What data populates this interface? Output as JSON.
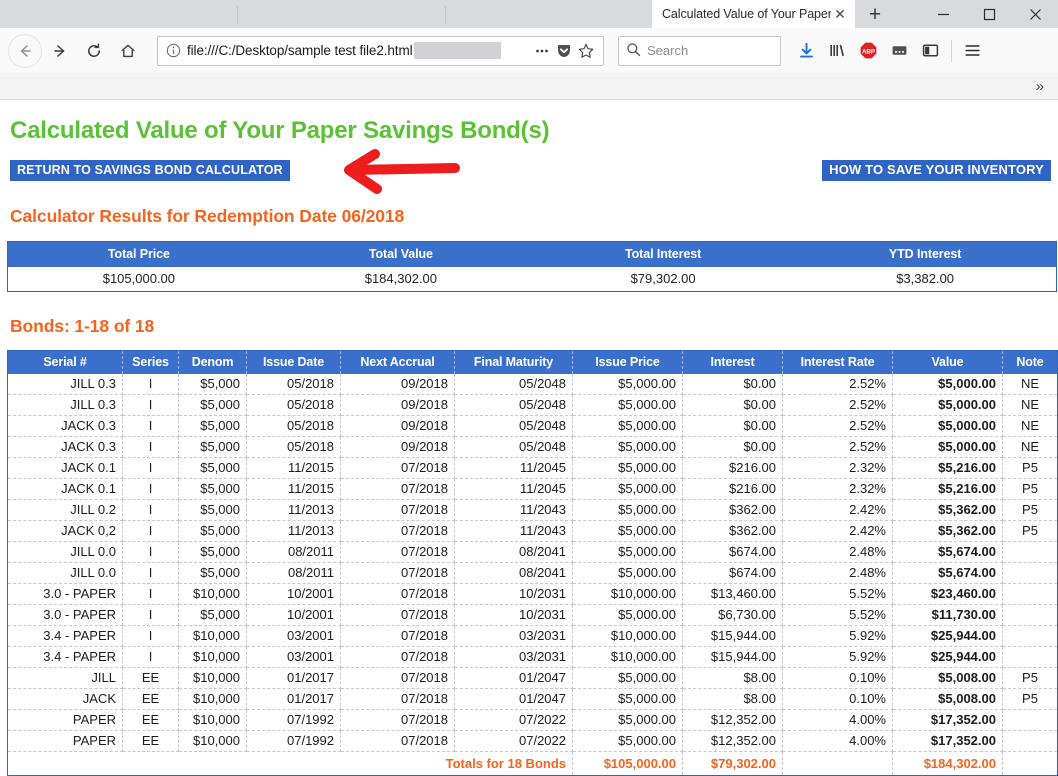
{
  "browser": {
    "tab": {
      "title": "Calculated Value of Your Paper",
      "close_label": "✕"
    },
    "new_tab_label": "+",
    "window_controls": {
      "minimize": "─",
      "maximize": "□",
      "close": "✕"
    },
    "nav": {
      "back": "back-arrow",
      "forward": "forward-arrow",
      "reload": "reload-arrow",
      "home": "home-house"
    },
    "url": {
      "value": "file:///C:/Desktop/sample test file2.html",
      "identity_icon": "info-circle",
      "page_actions": "ellipsis",
      "pocket": "pocket-shield",
      "bookmark": "star-outline"
    },
    "search": {
      "placeholder": "Search",
      "icon": "magnifier"
    },
    "toolbar_icons": [
      {
        "name": "downloads",
        "label": ""
      },
      {
        "name": "library",
        "label": ""
      },
      {
        "name": "adblock-plus",
        "label": "ABP"
      },
      {
        "name": "pocket-list",
        "label": ""
      },
      {
        "name": "sidebar-toggle",
        "label": ""
      },
      {
        "name": "app-menu",
        "label": ""
      }
    ],
    "bookmarks_overflow": "»"
  },
  "page": {
    "title": "Calculated Value of Your Paper Savings Bond(s)",
    "buttons": {
      "return_calculator": "RETURN TO SAVINGS BOND CALCULATOR",
      "how_to_save": "HOW TO SAVE YOUR INVENTORY"
    },
    "annotation": {
      "type": "red-left-arrow",
      "color": "#ee1c1c"
    },
    "results_heading": "Calculator Results for Redemption Date 06/2018",
    "bonds_heading": "Bonds: 1-18 of 18"
  },
  "colors": {
    "title_green": "#5ac334",
    "heading_orange": "#f4641e",
    "table_blue": "#3b6fcc",
    "button_blue": "#2f63c4",
    "arrow_red": "#ee1c1c"
  },
  "summary": {
    "headers": [
      "Total Price",
      "Total Value",
      "Total Interest",
      "YTD Interest"
    ],
    "values": [
      "$105,000.00",
      "$184,302.00",
      "$79,302.00",
      "$3,382.00"
    ]
  },
  "bonds_table": {
    "headers": [
      "Serial #",
      "Series",
      "Denom",
      "Issue Date",
      "Next Accrual",
      "Final Maturity",
      "Issue Price",
      "Interest",
      "Interest Rate",
      "Value",
      "Note"
    ],
    "rows": [
      [
        "JILL 0.3",
        "I",
        "$5,000",
        "05/2018",
        "09/2018",
        "05/2048",
        "$5,000.00",
        "$0.00",
        "2.52%",
        "$5,000.00",
        "NE"
      ],
      [
        "JILL 0.3",
        "I",
        "$5,000",
        "05/2018",
        "09/2018",
        "05/2048",
        "$5,000.00",
        "$0.00",
        "2.52%",
        "$5,000.00",
        "NE"
      ],
      [
        "JACK 0.3",
        "I",
        "$5,000",
        "05/2018",
        "09/2018",
        "05/2048",
        "$5,000.00",
        "$0.00",
        "2.52%",
        "$5,000.00",
        "NE"
      ],
      [
        "JACK 0.3",
        "I",
        "$5,000",
        "05/2018",
        "09/2018",
        "05/2048",
        "$5,000.00",
        "$0.00",
        "2.52%",
        "$5,000.00",
        "NE"
      ],
      [
        "JACK 0.1",
        "I",
        "$5,000",
        "11/2015",
        "07/2018",
        "11/2045",
        "$5,000.00",
        "$216.00",
        "2.32%",
        "$5,216.00",
        "P5"
      ],
      [
        "JACK 0.1",
        "I",
        "$5,000",
        "11/2015",
        "07/2018",
        "11/2045",
        "$5,000.00",
        "$216.00",
        "2.32%",
        "$5,216.00",
        "P5"
      ],
      [
        "JILL 0.2",
        "I",
        "$5,000",
        "11/2013",
        "07/2018",
        "11/2043",
        "$5,000.00",
        "$362.00",
        "2.42%",
        "$5,362.00",
        "P5"
      ],
      [
        "JACK 0,2",
        "I",
        "$5,000",
        "11/2013",
        "07/2018",
        "11/2043",
        "$5,000.00",
        "$362.00",
        "2.42%",
        "$5,362.00",
        "P5"
      ],
      [
        "JILL 0.0",
        "I",
        "$5,000",
        "08/2011",
        "07/2018",
        "08/2041",
        "$5,000.00",
        "$674.00",
        "2.48%",
        "$5,674.00",
        ""
      ],
      [
        "JILL 0.0",
        "I",
        "$5,000",
        "08/2011",
        "07/2018",
        "08/2041",
        "$5,000.00",
        "$674.00",
        "2.48%",
        "$5,674.00",
        ""
      ],
      [
        "3.0 - PAPER",
        "I",
        "$10,000",
        "10/2001",
        "07/2018",
        "10/2031",
        "$10,000.00",
        "$13,460.00",
        "5.52%",
        "$23,460.00",
        ""
      ],
      [
        "3.0 - PAPER",
        "I",
        "$5,000",
        "10/2001",
        "07/2018",
        "10/2031",
        "$5,000.00",
        "$6,730.00",
        "5.52%",
        "$11,730.00",
        ""
      ],
      [
        "3.4 - PAPER",
        "I",
        "$10,000",
        "03/2001",
        "07/2018",
        "03/2031",
        "$10,000.00",
        "$15,944.00",
        "5.92%",
        "$25,944.00",
        ""
      ],
      [
        "3.4 - PAPER",
        "I",
        "$10,000",
        "03/2001",
        "07/2018",
        "03/2031",
        "$10,000.00",
        "$15,944.00",
        "5.92%",
        "$25,944.00",
        ""
      ],
      [
        "JILL",
        "EE",
        "$10,000",
        "01/2017",
        "07/2018",
        "01/2047",
        "$5,000.00",
        "$8.00",
        "0.10%",
        "$5,008.00",
        "P5"
      ],
      [
        "JACK",
        "EE",
        "$10,000",
        "01/2017",
        "07/2018",
        "01/2047",
        "$5,000.00",
        "$8.00",
        "0.10%",
        "$5,008.00",
        "P5"
      ],
      [
        "PAPER",
        "EE",
        "$10,000",
        "07/1992",
        "07/2018",
        "07/2022",
        "$5,000.00",
        "$12,352.00",
        "4.00%",
        "$17,352.00",
        ""
      ],
      [
        "PAPER",
        "EE",
        "$10,000",
        "07/1992",
        "07/2018",
        "07/2022",
        "$5,000.00",
        "$12,352.00",
        "4.00%",
        "$17,352.00",
        ""
      ]
    ],
    "totals": {
      "label": "Totals for 18 Bonds",
      "issue_price": "$105,000.00",
      "interest": "$79,302.00",
      "rate": "",
      "value": "$184,302.00",
      "note": ""
    }
  }
}
